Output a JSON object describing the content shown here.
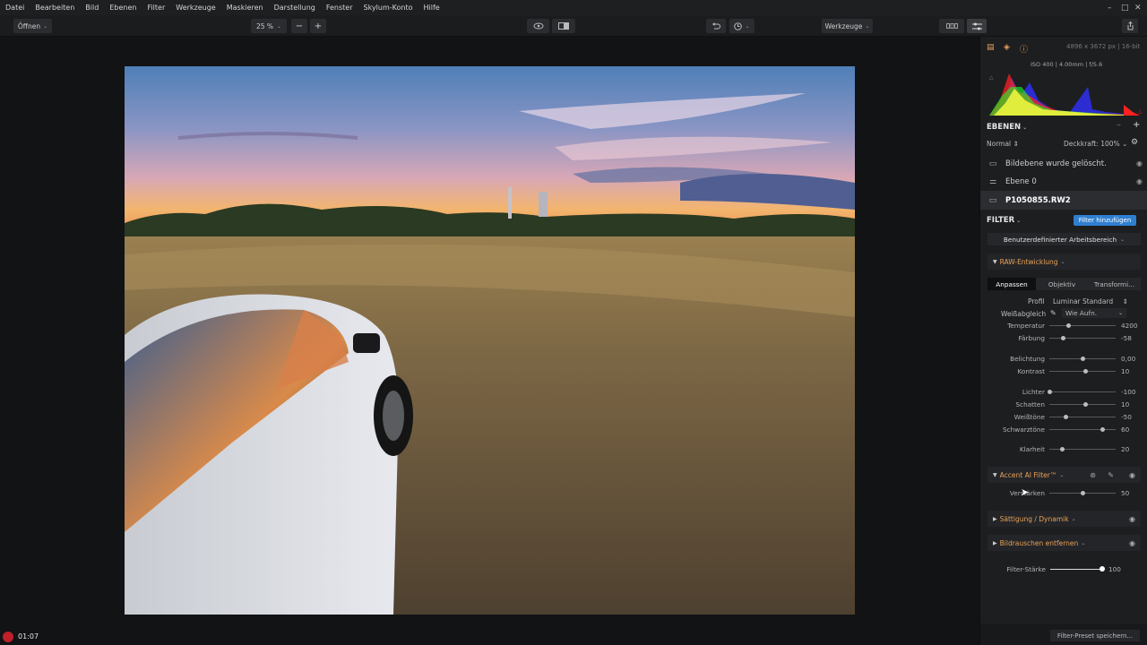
{
  "menu": [
    "Datei",
    "Bearbeiten",
    "Bild",
    "Ebenen",
    "Filter",
    "Werkzeuge",
    "Maskieren",
    "Darstellung",
    "Fenster",
    "Skylum-Konto",
    "Hilfe"
  ],
  "window_controls": {
    "minimize": "–",
    "maximize": "□",
    "close": "✕"
  },
  "toolbar": {
    "open_label": "Öffnen",
    "zoom_value": "25 %",
    "zoom_out": "−",
    "zoom_in": "+",
    "tools_label": "Werkzeuge"
  },
  "info": {
    "dimensions": "4896 x 3672 px  |  16-bit",
    "exif": "ISO 400  |  4.00mm  |  f/5.6"
  },
  "layers": {
    "title": "EBENEN",
    "blend_mode": "Normal",
    "opacity_label": "Deckkraft: 100%",
    "items": [
      {
        "label": "Bildebene wurde gelöscht."
      },
      {
        "label": "Ebene 0"
      },
      {
        "label": "P1050855.RW2"
      }
    ]
  },
  "filter": {
    "title": "FILTER",
    "add_button": "Filter hinzufügen",
    "workspace": "Benutzerdefinierter Arbeitsbereich",
    "raw_group": "RAW-Entwicklung",
    "tabs": [
      "Anpassen",
      "Objektiv",
      "Transformi..."
    ],
    "profile_label": "Profil",
    "profile_value": "Luminar Standard",
    "wb_label": "Weißabgleich",
    "wb_value": "Wie Aufn.",
    "sliders_raw": [
      {
        "label": "Temperatur",
        "value": "4200",
        "pos": 0.29
      },
      {
        "label": "Färbung",
        "value": "-58",
        "pos": 0.21
      },
      {
        "label": "Belichtung",
        "value": "0,00",
        "pos": 0.5
      },
      {
        "label": "Kontrast",
        "value": "10",
        "pos": 0.55
      },
      {
        "label": "Lichter",
        "value": "-100",
        "pos": 0.0
      },
      {
        "label": "Schatten",
        "value": "10",
        "pos": 0.55
      },
      {
        "label": "Weißtöne",
        "value": "-50",
        "pos": 0.25
      },
      {
        "label": "Schwarztöne",
        "value": "60",
        "pos": 0.8
      },
      {
        "label": "Klarheit",
        "value": "20",
        "pos": 0.2
      }
    ],
    "accent_group": "Accent AI Filter™",
    "accent_slider": {
      "label": "Verstärken",
      "value": "50",
      "pos": 0.5
    },
    "saturation_group": "Sättigung / Dynamik",
    "denoise_group": "Bildrauschen entfernen",
    "strength_slider": {
      "label": "Filter-Stärke",
      "value": "100",
      "pos": 1.0
    },
    "save_preset": "Filter-Preset speichern..."
  },
  "recording_time": "01:07",
  "colors": {
    "accent_blue": "#2f7fd1",
    "orange": "#e8a25a"
  }
}
